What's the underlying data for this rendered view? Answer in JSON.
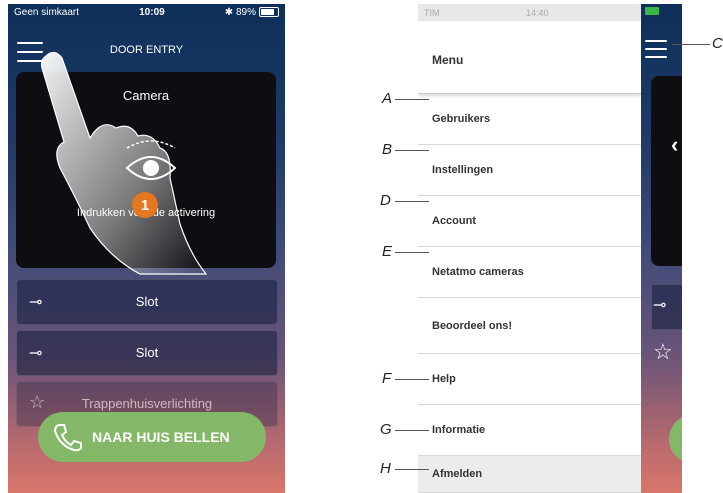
{
  "left_phone": {
    "status": {
      "carrier": "Geen simkaart",
      "time": "10:09",
      "battery": "89%"
    },
    "header_title": "DOOR ENTRY",
    "camera": {
      "title": "Camera",
      "activate_text": "Indrukken voor de activering"
    },
    "locks": [
      {
        "label": "Slot"
      },
      {
        "label": "Slot"
      }
    ],
    "stairs_light": "Trappenhuisverlichting",
    "call_button": "NAAR HUIS BELLEN",
    "step_badge": "1"
  },
  "menu": {
    "status": {
      "carrier": "TIM",
      "time": "14:40"
    },
    "title": "Menu",
    "items": [
      {
        "label": "Gebruikers",
        "callout": "A"
      },
      {
        "label": "Instellingen",
        "callout": "B"
      },
      {
        "label": "Account",
        "callout": "D"
      },
      {
        "label": "Netatmo cameras",
        "callout": "E"
      },
      {
        "label": "Beoordeel ons!",
        "callout": ""
      },
      {
        "label": "Help",
        "callout": "F"
      },
      {
        "label": "Informatie",
        "callout": "G"
      },
      {
        "label": "Afmelden",
        "callout": "H"
      }
    ],
    "hamburger_callout": "C"
  },
  "colors": {
    "call_button": "#84b868",
    "badge": "#e5771f",
    "background_top": "#0e2f5a",
    "background_bottom": "#d8766a"
  }
}
